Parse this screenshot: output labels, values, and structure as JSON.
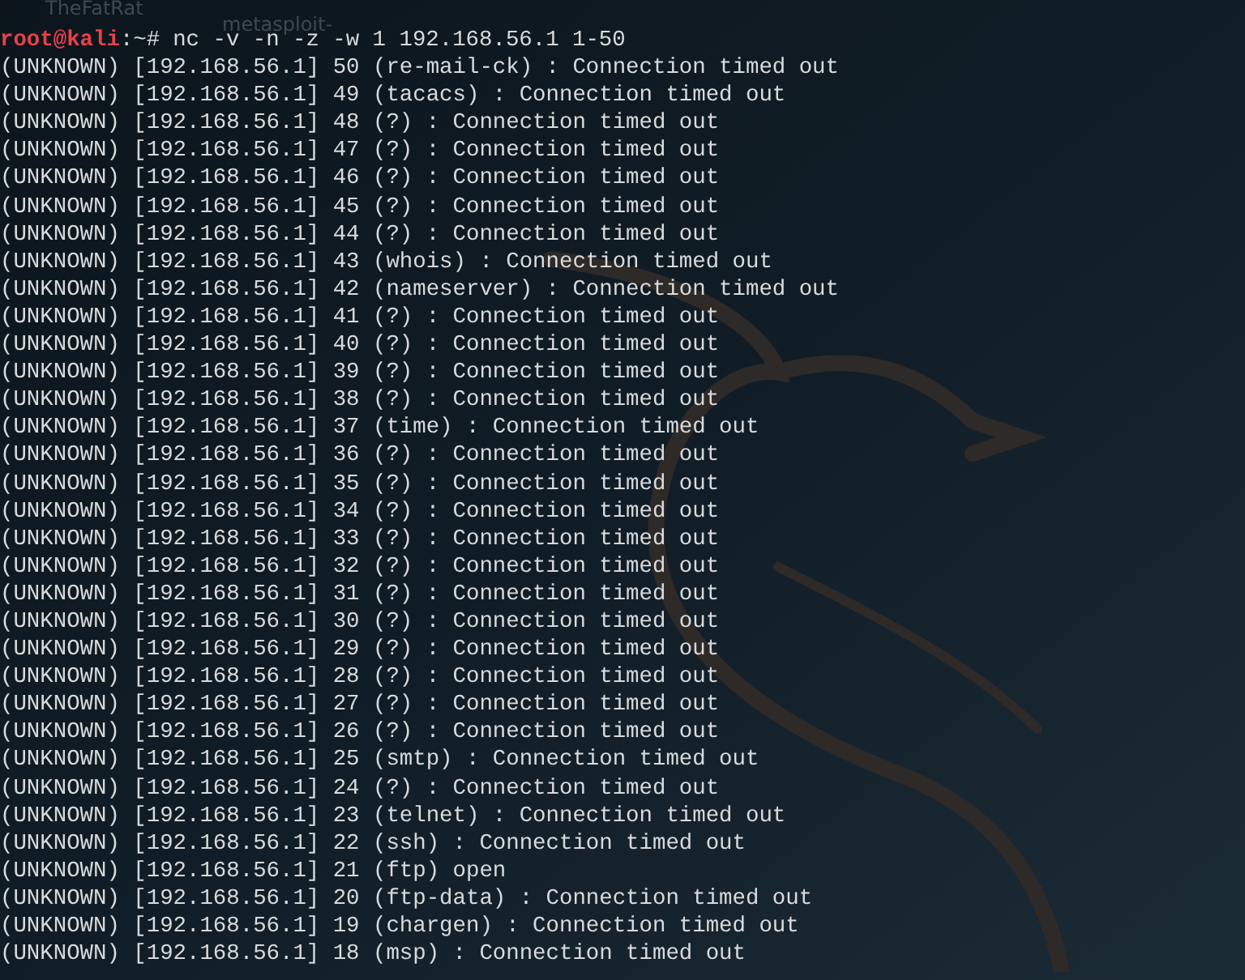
{
  "desktop_labels": [
    "TheFatRat",
    "metasploit-"
  ],
  "prompt": {
    "user_host": "root@kali",
    "path": ":~#",
    "command": "nc -v -n -z -w 1 192.168.56.1 1-50"
  },
  "lines": [
    "(UNKNOWN) [192.168.56.1] 50 (re-mail-ck) : Connection timed out",
    "(UNKNOWN) [192.168.56.1] 49 (tacacs) : Connection timed out",
    "(UNKNOWN) [192.168.56.1] 48 (?) : Connection timed out",
    "(UNKNOWN) [192.168.56.1] 47 (?) : Connection timed out",
    "(UNKNOWN) [192.168.56.1] 46 (?) : Connection timed out",
    "(UNKNOWN) [192.168.56.1] 45 (?) : Connection timed out",
    "(UNKNOWN) [192.168.56.1] 44 (?) : Connection timed out",
    "(UNKNOWN) [192.168.56.1] 43 (whois) : Connection timed out",
    "(UNKNOWN) [192.168.56.1] 42 (nameserver) : Connection timed out",
    "(UNKNOWN) [192.168.56.1] 41 (?) : Connection timed out",
    "(UNKNOWN) [192.168.56.1] 40 (?) : Connection timed out",
    "(UNKNOWN) [192.168.56.1] 39 (?) : Connection timed out",
    "(UNKNOWN) [192.168.56.1] 38 (?) : Connection timed out",
    "(UNKNOWN) [192.168.56.1] 37 (time) : Connection timed out",
    "(UNKNOWN) [192.168.56.1] 36 (?) : Connection timed out",
    "(UNKNOWN) [192.168.56.1] 35 (?) : Connection timed out",
    "(UNKNOWN) [192.168.56.1] 34 (?) : Connection timed out",
    "(UNKNOWN) [192.168.56.1] 33 (?) : Connection timed out",
    "(UNKNOWN) [192.168.56.1] 32 (?) : Connection timed out",
    "(UNKNOWN) [192.168.56.1] 31 (?) : Connection timed out",
    "(UNKNOWN) [192.168.56.1] 30 (?) : Connection timed out",
    "(UNKNOWN) [192.168.56.1] 29 (?) : Connection timed out",
    "(UNKNOWN) [192.168.56.1] 28 (?) : Connection timed out",
    "(UNKNOWN) [192.168.56.1] 27 (?) : Connection timed out",
    "(UNKNOWN) [192.168.56.1] 26 (?) : Connection timed out",
    "(UNKNOWN) [192.168.56.1] 25 (smtp) : Connection timed out",
    "(UNKNOWN) [192.168.56.1] 24 (?) : Connection timed out",
    "(UNKNOWN) [192.168.56.1] 23 (telnet) : Connection timed out",
    "(UNKNOWN) [192.168.56.1] 22 (ssh) : Connection timed out",
    "(UNKNOWN) [192.168.56.1] 21 (ftp) open",
    "(UNKNOWN) [192.168.56.1] 20 (ftp-data) : Connection timed out",
    "(UNKNOWN) [192.168.56.1] 19 (chargen) : Connection timed out",
    "(UNKNOWN) [192.168.56.1] 18 (msp) : Connection timed out"
  ]
}
